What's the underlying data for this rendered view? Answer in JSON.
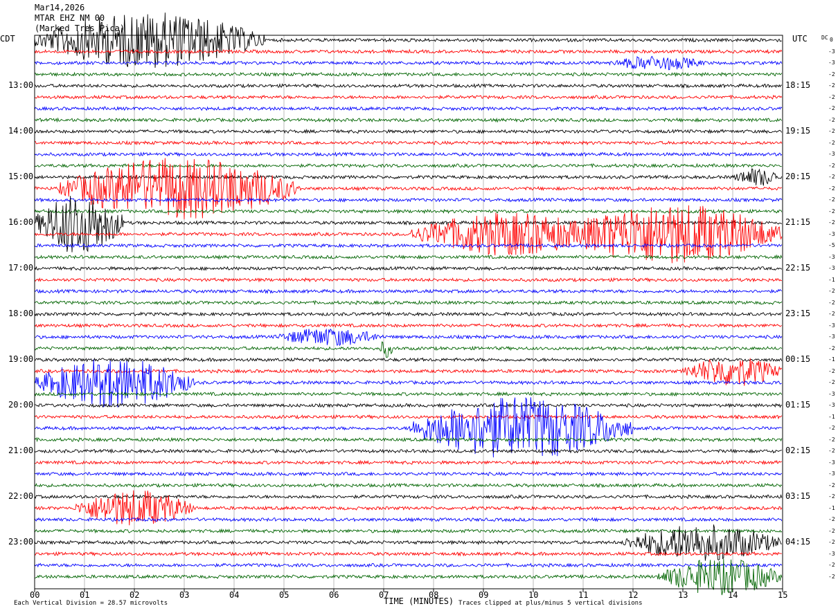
{
  "header": {
    "date": "Mar14,2026",
    "station": "MTAR EHZ NM 00",
    "note": "(Marked Tres Pica)",
    "left_zone": "CDT",
    "right_zone": "UTC",
    "dc_label": "DC"
  },
  "footer": {
    "scale_note": "Each Vertical Division =   28.57 microvolts",
    "x_title": "TIME (MINUTES)",
    "clip_note": "Traces clipped at plus/minus 5 vertical divisions"
  },
  "chart_data": {
    "type": "line",
    "title": "MTAR EHZ NM 00",
    "xlabel": "TIME (MINUTES)",
    "x_ticks": [
      "00",
      "01",
      "02",
      "03",
      "04",
      "05",
      "06",
      "07",
      "08",
      "09",
      "10",
      "11",
      "12",
      "13",
      "14",
      "15"
    ],
    "xlim": [
      0,
      15
    ],
    "row_minutes": 15,
    "row_count": 48,
    "trace_colors": [
      "#000000",
      "#ff0000",
      "#0000ff",
      "#006400"
    ],
    "left_time_labels": [
      "13:00",
      "14:00",
      "15:00",
      "16:00",
      "17:00",
      "18:00",
      "19:00",
      "20:00",
      "21:00",
      "22:00",
      "23:00"
    ],
    "right_time_labels": [
      "18:15",
      "19:15",
      "20:15",
      "21:15",
      "22:15",
      "23:15",
      "00:15",
      "01:15",
      "02:15",
      "03:15",
      "04:15"
    ],
    "dc_offsets": [
      "0",
      "-3",
      "-3",
      "-2",
      "-2",
      "-2",
      "-2",
      "-2",
      "-2",
      "-2",
      "-3",
      "-2",
      "-2",
      "-2",
      "-2",
      "-2",
      "-2",
      "-3",
      "-5",
      "-3",
      "-3",
      "-1",
      "-2",
      "-2",
      "-2",
      "-3",
      "-3",
      "-2",
      "-1",
      "-2",
      "-2",
      "-3",
      "-3",
      "-1",
      "-2",
      "-2",
      "-2",
      "-3",
      "-3",
      "-2",
      "-2",
      "-1",
      "-2",
      "-2",
      "-2",
      "-3",
      "-2",
      "-2"
    ],
    "events": [
      {
        "row": 0,
        "start_min": 0.0,
        "end_min": 4.6,
        "amplitude": 4.5
      },
      {
        "row": 2,
        "start_min": 11.5,
        "end_min": 13.5,
        "amplitude": 1.2
      },
      {
        "row": 13,
        "start_min": 0.5,
        "end_min": 5.3,
        "amplitude": 5.0
      },
      {
        "row": 12,
        "start_min": 14.0,
        "end_min": 15.0,
        "amplitude": 1.5
      },
      {
        "row": 16,
        "start_min": 0.0,
        "end_min": 1.8,
        "amplitude": 5.0
      },
      {
        "row": 17,
        "start_min": 7.5,
        "end_min": 11.5,
        "amplitude": 3.5
      },
      {
        "row": 17,
        "start_min": 10.5,
        "end_min": 15.0,
        "amplitude": 5.0
      },
      {
        "row": 26,
        "start_min": 4.8,
        "end_min": 7.0,
        "amplitude": 1.5
      },
      {
        "row": 27,
        "start_min": 6.9,
        "end_min": 7.2,
        "amplitude": 1.5
      },
      {
        "row": 29,
        "start_min": 13.0,
        "end_min": 15.0,
        "amplitude": 2.5
      },
      {
        "row": 30,
        "start_min": 0.0,
        "end_min": 3.2,
        "amplitude": 4.0
      },
      {
        "row": 34,
        "start_min": 7.5,
        "end_min": 12.0,
        "amplitude": 5.0
      },
      {
        "row": 41,
        "start_min": 0.8,
        "end_min": 3.2,
        "amplitude": 3.0
      },
      {
        "row": 44,
        "start_min": 11.8,
        "end_min": 15.0,
        "amplitude": 3.0
      },
      {
        "row": 47,
        "start_min": 12.5,
        "end_min": 15.0,
        "amplitude": 3.0
      }
    ]
  }
}
